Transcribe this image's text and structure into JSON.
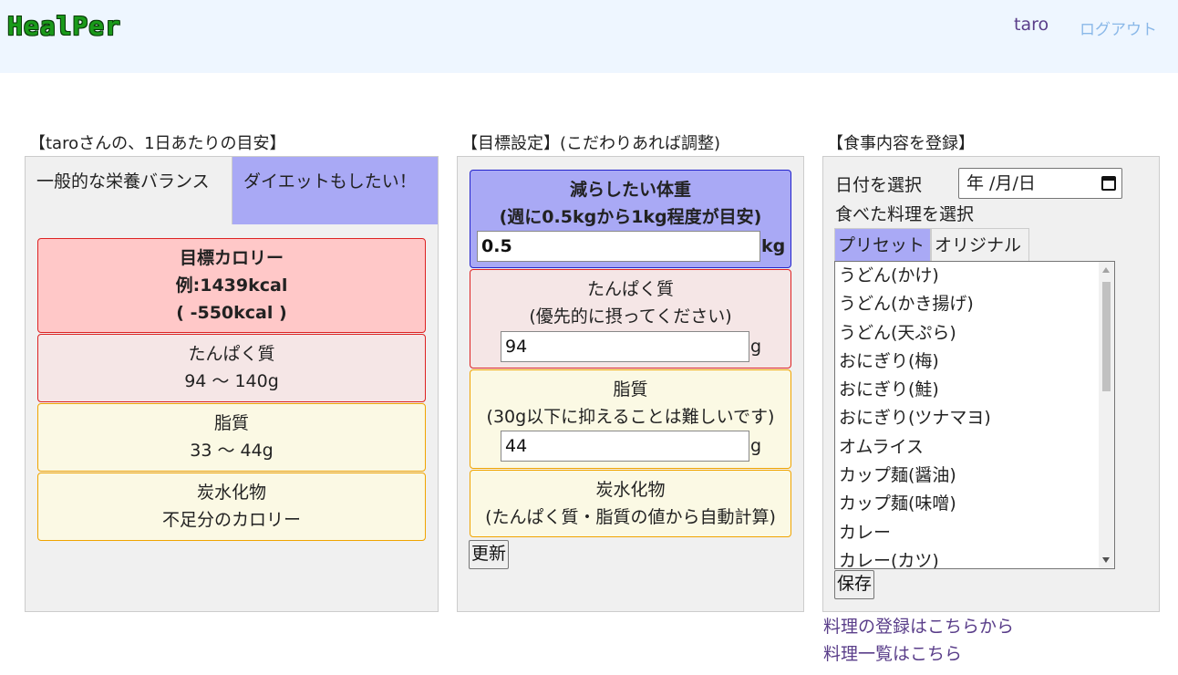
{
  "header": {
    "logo": "HealPer",
    "user": "taro",
    "logout": "ログアウト"
  },
  "col1": {
    "title": "【taroさんの、1日あたりの目安】",
    "tabs": [
      "一般的な栄養バランス",
      "ダイエットもしたい！"
    ],
    "active_tab": "ダイエットもしたい！",
    "calorie": {
      "title": "目標カロリー",
      "example": "例:1439kcal",
      "diff": "( -550kcal )"
    },
    "protein": {
      "title": "たんぱく質",
      "range": "94 ～ 140g"
    },
    "fat": {
      "title": "脂質",
      "range": "33 ～ 44g"
    },
    "carb": {
      "title": "炭水化物",
      "note": "不足分のカロリー"
    }
  },
  "col2": {
    "title": "【目標設定】(こだわりあれば調整)",
    "weight": {
      "title": "減らしたい体重",
      "note": "(週に0.5kgから1kg程度が目安)",
      "value": "0.5",
      "unit": "kg"
    },
    "protein": {
      "title": "たんぱく質",
      "note": "(優先的に摂ってください)",
      "value": "94",
      "unit": "g"
    },
    "fat": {
      "title": "脂質",
      "note": "(30g以下に抑えることは難しいです)",
      "value": "44",
      "unit": "g"
    },
    "carb": {
      "title": "炭水化物",
      "note": "(たんぱく質・脂質の値から自動計算)"
    },
    "update_button": "更新"
  },
  "col3": {
    "title": "【食事内容を登録】",
    "date_label": "日付を選択",
    "date_placeholder": "年 /月/日",
    "dish_label": "食べた料理を選択",
    "tabs": [
      "プリセット",
      "オリジナル"
    ],
    "active_tab": "プリセット",
    "dishes": [
      "うどん(かけ)",
      "うどん(かき揚げ)",
      "うどん(天ぷら)",
      "おにぎり(梅)",
      "おにぎり(鮭)",
      "おにぎり(ツナマヨ)",
      "オムライス",
      "カップ麺(醤油)",
      "カップ麺(味噌)",
      "カレー",
      "カレー(カツ)"
    ],
    "save_button": "保存"
  },
  "footer_links": [
    "料理の登録はこちらから",
    "料理一覧はこちら"
  ],
  "colors": {
    "header_bg": "#eef6ff",
    "accent_purple": "#a9a9f5",
    "red_box": "#ffc8c8",
    "pink_box": "#f5e6e6",
    "yellow_box": "#fbf9e4",
    "link": "#5a3e8a"
  }
}
